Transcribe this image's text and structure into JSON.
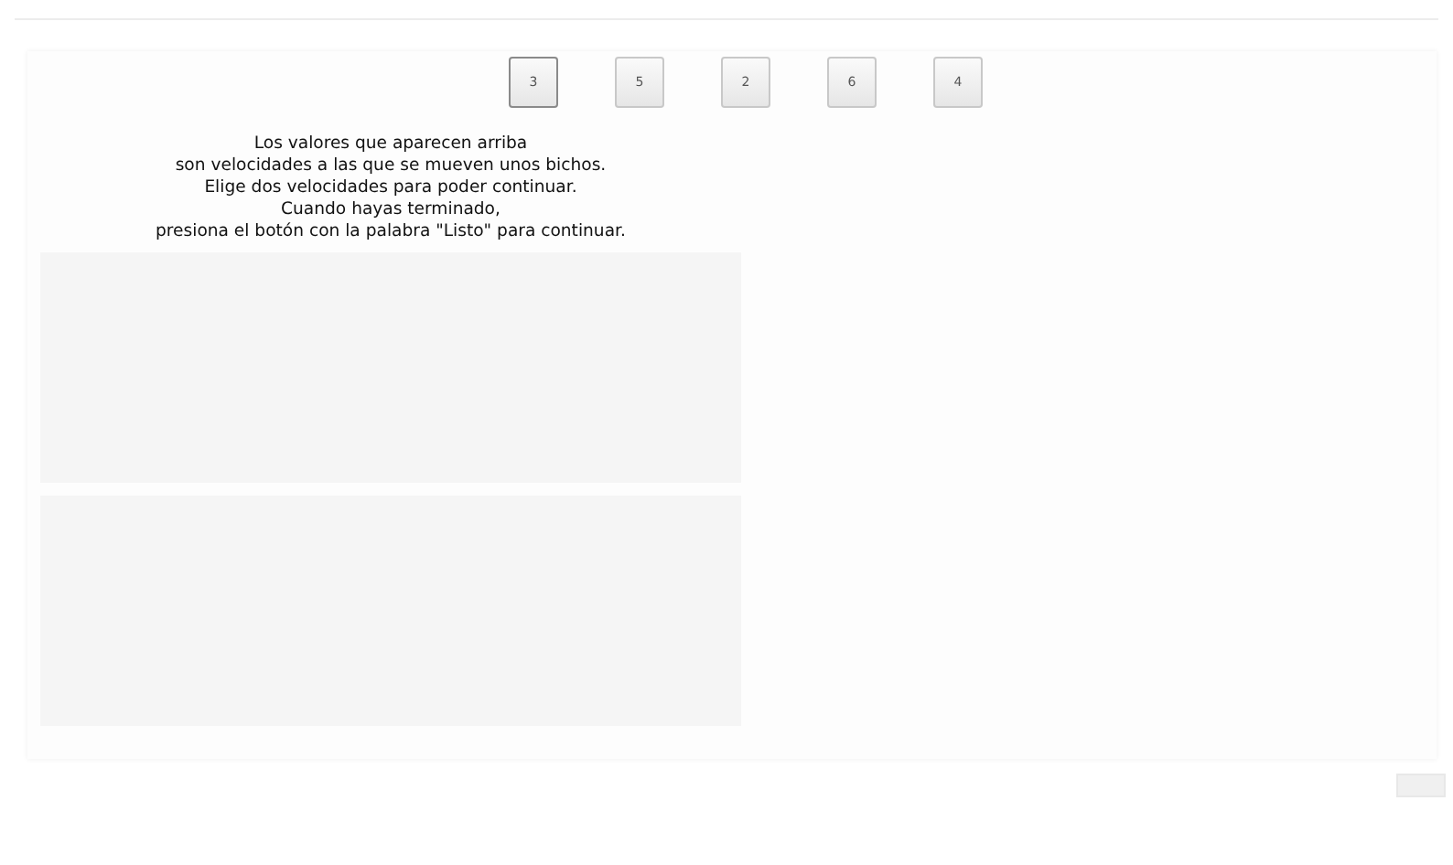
{
  "speed_buttons": [
    {
      "label": "3",
      "selected": true
    },
    {
      "label": "5",
      "selected": false
    },
    {
      "label": "2",
      "selected": false
    },
    {
      "label": "6",
      "selected": false
    },
    {
      "label": "4",
      "selected": false
    }
  ],
  "instructions": [
    "Los valores que aparecen arriba",
    "son velocidades a las que se mueven unos bichos.",
    "Elige dos velocidades para poder continuar.",
    "Cuando hayas terminado,",
    "presiona el botón con la palabra \"Listo\" para continuar."
  ],
  "drop_zones": [
    {
      "kind": "zone"
    },
    {
      "kind": "zone"
    }
  ]
}
